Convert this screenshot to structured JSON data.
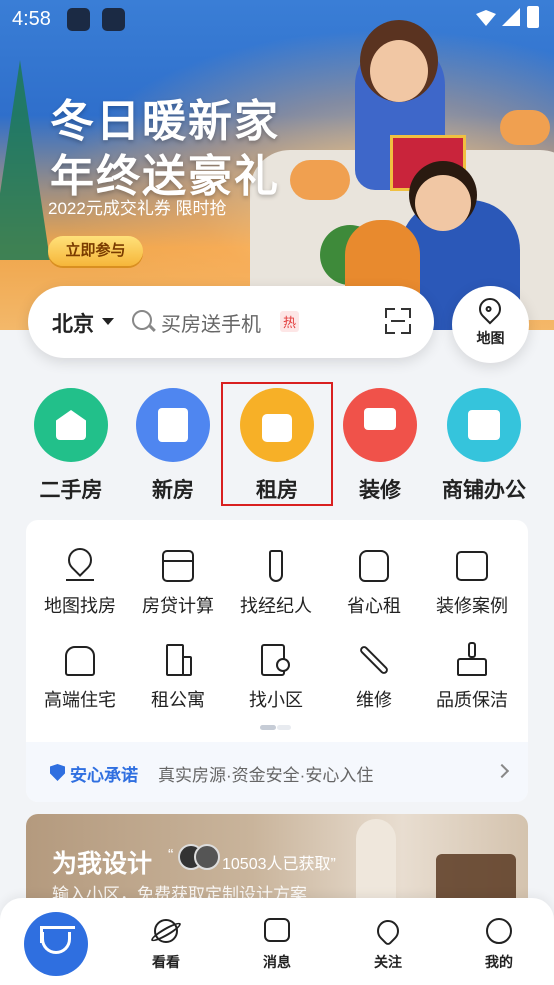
{
  "status_bar": {
    "time": "4:58"
  },
  "banner": {
    "title_line1": "冬日暖新家",
    "title_line2": "年终送豪礼",
    "subtitle": "2022元成交礼券 限时抢",
    "cta": "立即参与"
  },
  "search": {
    "city": "北京",
    "placeholder": "买房送手机",
    "hot_badge": "热"
  },
  "map_button": {
    "label": "地图"
  },
  "categories": [
    {
      "label": "二手房",
      "color": "#22c08a",
      "icon": "house-icon"
    },
    {
      "label": "新房",
      "color": "#4f86f0",
      "icon": "building-icon"
    },
    {
      "label": "租房",
      "color": "#f7b027",
      "icon": "bag-icon"
    },
    {
      "label": "装修",
      "color": "#f0524a",
      "icon": "paint-roller-icon"
    },
    {
      "label": "商铺办公",
      "color": "#35c4dc",
      "icon": "shop-icon"
    }
  ],
  "services": [
    {
      "label": "地图找房",
      "icon": "map-pin-icon"
    },
    {
      "label": "房贷计算",
      "icon": "calculator-icon"
    },
    {
      "label": "找经纪人",
      "icon": "tie-icon"
    },
    {
      "label": "省心租",
      "icon": "heart-house-icon"
    },
    {
      "label": "装修案例",
      "icon": "picture-icon"
    },
    {
      "label": "高端住宅",
      "icon": "villa-icon"
    },
    {
      "label": "租公寓",
      "icon": "apartment-icon"
    },
    {
      "label": "找小区",
      "icon": "community-search-icon"
    },
    {
      "label": "维修",
      "icon": "wrench-icon"
    },
    {
      "label": "品质保洁",
      "icon": "broom-icon"
    }
  ],
  "promise": {
    "title": "安心承诺",
    "text": "真实房源·资金安全·安心入住"
  },
  "design_card": {
    "title": "为我设计",
    "quote_open": "“",
    "count": "10503人已获取”",
    "subtitle": "输入小区，免费获取定制设计方案"
  },
  "tabbar": {
    "items": [
      {
        "label": "看看",
        "icon": "planet-icon"
      },
      {
        "label": "消息",
        "icon": "message-icon"
      },
      {
        "label": "关注",
        "icon": "heart-icon"
      },
      {
        "label": "我的",
        "icon": "smile-icon"
      }
    ]
  },
  "colors": {
    "accent": "#2f6fe0",
    "highlight_box": "#d92020"
  }
}
